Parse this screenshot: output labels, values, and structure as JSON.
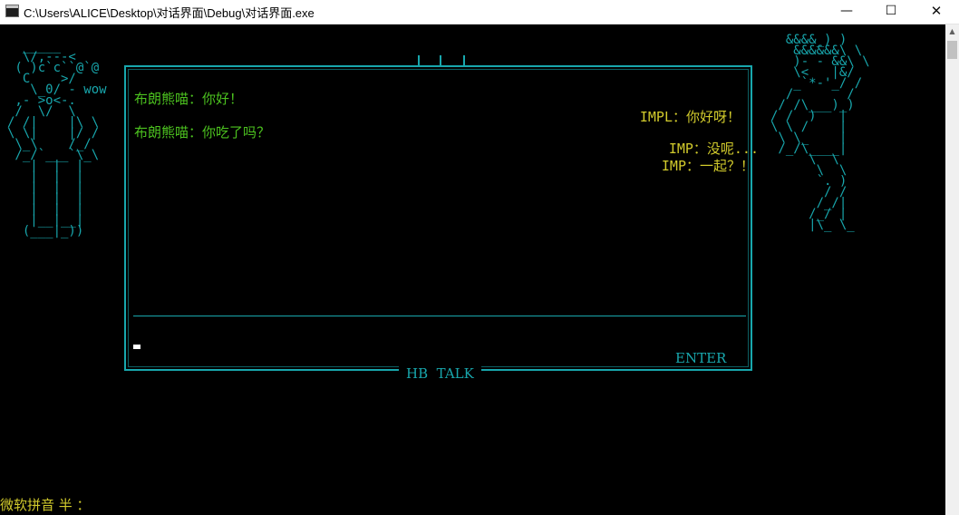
{
  "window": {
    "title": "C:\\Users\\ALICE\\Desktop\\对话界面\\Debug\\对话界面.exe",
    "minimize_glyph": "—",
    "maximize_glyph": "☐",
    "close_glyph": "✕"
  },
  "colors": {
    "background": "#000000",
    "frame": "#18a7ad",
    "left_speaker": "#4cc21f",
    "right_speaker": "#d2cb2c"
  },
  "left_figure_art": "  _____\n  \\/,---<\n ( )c`c``@`@\n  C    >/\n   \\_0/ - wow\n ,- >o<-.\n /  \\/  \\\n/ /|    |\\ \\\n\\ \\|    |/ /\n \\_\\    /_/\n /_/`___`\\_\\\n   |  |  |\n   |  |  |\n   |  |  |\n   |  |  |\n   |  |  |\n   |__|__|\n  (___|_))",
  "right_figure_art": "  &&&&_) )\n   &&&&&&\\ \\\n   )- - &&\\ \\\n   \\<   |&/\n   _`*-'_/ /\n  /       /\n / /\\___)_)\n/ /  )   |\n\\ \\ /    |\n \\ \\_    |\n /_/\\____|\n     \\  \\\n      \\  \\\n      `. )\n       / /\n      /_/|\n     /_/ |\n     |\\_ \\_",
  "messages": {
    "left": [
      "布朗熊喵：你好！",
      "布朗熊喵：你吃了吗？"
    ],
    "right": [
      "IMPL：你好呀！",
      "IMP：没呢...",
      "IMP：一起？！"
    ]
  },
  "input": {
    "enter_label": "ENTER"
  },
  "footer_label": "HB  TALK",
  "status_bar": {
    "ime_text": "微软拼音 半 ："
  }
}
